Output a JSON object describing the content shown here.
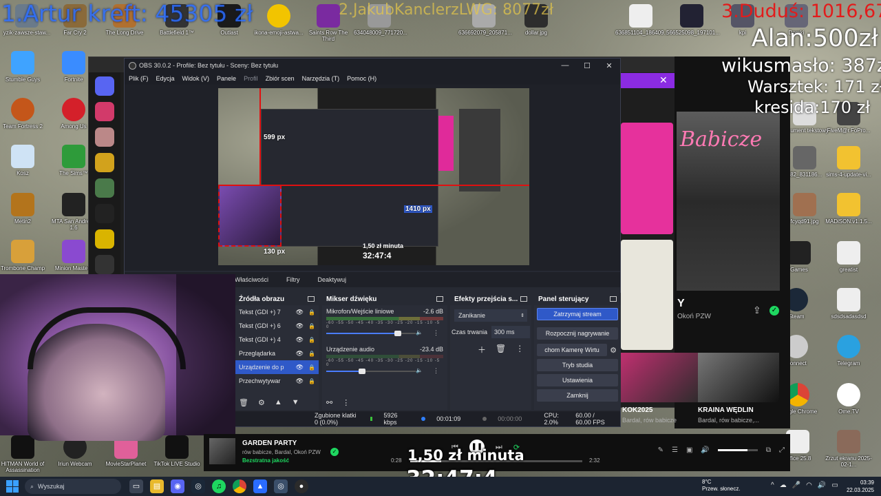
{
  "overlay": {
    "top1": "1.Artur kreft: 45305 zł",
    "top2": "2.JakubKanclerzLWG: 8077zł",
    "top3": "3.Duduś: 1016,67zł",
    "r1": "Alan:500zł",
    "r2": "wikusmasło: 387zł",
    "r3": "Warsztek: 171 zł",
    "r4": "kresida:170 zł",
    "rate": "1,50 zł minuta",
    "timer": "32:47:4"
  },
  "desktop": {
    "top_labels": [
      "yzik-zawsze-staw...",
      "Far Cry 2",
      "The Long Drive",
      "Battlefield 1™",
      "Outlast",
      "ikona-emoji-astwa...",
      "Saints Row The Third",
      "634048009_771720...",
      "636692079_205871...",
      "dollar.jpg",
      "636851104_186409...",
      "566525098_197101...",
      "kpi",
      "Domki"
    ],
    "left_col": [
      "Stumble Guys",
      "Team Fortress 2",
      "Kosz",
      "Metin2",
      "Trombone Champ"
    ],
    "left_col2": [
      "Fortnite",
      "Among Us",
      "The Sims™",
      "MTA San Andreas 1.6",
      "Minion Masters"
    ],
    "right_col": [
      "Dokument tekstowy",
      "FiveM@r.FoPro...",
      "282_831186...",
      "sims-4-update-vi...",
      "fcyqd91.jpg",
      "MADiSON.v1.1.5...",
      "Games",
      "greatist",
      "Steam",
      "sdsdsadasdsd",
      "Connect",
      "Telegram",
      "Google Chrome",
      "Ome.TV",
      "Office 25.8",
      "Zrzut ekranu 2025-02-1..."
    ],
    "bottom_row": [
      "HITMAN World of Assassination",
      "Iriun Webcam",
      "MovieStarPlanet",
      "TikTok LIVE Studio"
    ]
  },
  "obs": {
    "title": "OBS 30.0.2 - Profile: Bez tytułu - Sceny: Bez tytułu",
    "menu": [
      "Plik (F)",
      "Edycja",
      "Widok (V)",
      "Panele",
      "Profil",
      "Zbiór scen",
      "Narzędzia (T)",
      "Pomoc (H)"
    ],
    "preview": {
      "label_599": "599 px",
      "label_1410": "1410 px",
      "label_130": "130 px",
      "rate": "1,50 zł minuta",
      "timer": "32:47:4"
    },
    "context_bar": [
      "Właściwości",
      "Filtry",
      "Deaktywuj"
    ],
    "sources": {
      "title": "Źródła obrazu",
      "items": [
        {
          "name": "Tekst (GDI +) 7",
          "selected": false
        },
        {
          "name": "Tekst (GDI +) 6",
          "selected": false
        },
        {
          "name": "Tekst (GDI +) 4",
          "selected": false
        },
        {
          "name": "Przeglądarka",
          "selected": false
        },
        {
          "name": "Urządzenie do p",
          "selected": true
        },
        {
          "name": "Przechwytywar",
          "selected": false
        }
      ]
    },
    "mixer": {
      "title": "Mikser dźwięku",
      "channels": [
        {
          "name": "Mikrofon/Wejście liniowe",
          "db": "-2.6 dB",
          "volume": 0.8
        },
        {
          "name": "Urządzenie audio",
          "db": "-23.4 dB",
          "volume": 0.4
        }
      ],
      "ticks": "-60 -55 -50 -45 -40 -35 -30 -25 -20 -15 -10 -5 0"
    },
    "transitions": {
      "title": "Efekty przejścia s...",
      "selected": "Zanikanie",
      "duration_label": "Czas trwania",
      "duration": "300 ms"
    },
    "controls": {
      "title": "Panel sterujący",
      "buttons": [
        "Zatrzymaj stream",
        "Rozpocznij nagrywanie",
        "chom Kamerę Wirtu",
        "Tryb studia",
        "Ustawienia",
        "Zamknij"
      ]
    },
    "status": {
      "dropped": "Zgubione klatki 0 (0.0%)",
      "bitrate": "5926 kbps",
      "stream_time": "00:01:09",
      "rec_time": "00:00:00",
      "cpu": "CPU: 2.0%",
      "fps": "60.00 / 60.00 FPS"
    }
  },
  "spotify": {
    "album_title": "Babicze",
    "artist_label": "Okoń PZW",
    "cards": [
      {
        "title": "KOK2025",
        "sub": "Bardal, rów babicze"
      },
      {
        "title": "KRAINA WĘDLIN",
        "sub": "Bardal, rów babicze,..."
      }
    ],
    "now_playing": {
      "title": "GARDEN PARTY",
      "artist": "rów babicze, Bardal, Okoń PZW",
      "quality": "Bezstratna jakość",
      "elapsed": "0:28",
      "duration": "2:32",
      "progress": 0.18,
      "volume": 0.75
    }
  },
  "taskbar": {
    "search_placeholder": "Wyszukaj",
    "weather_temp": "8°C",
    "weather_desc": "Przew. słonecz.",
    "time": "03:39",
    "date": "22.03.2025"
  },
  "colors": {
    "obs_accent": "#2f59c8",
    "spotify_green": "#1ed760",
    "overlay_top1": "#2a6cff",
    "overlay_top3": "#e21c1c"
  }
}
